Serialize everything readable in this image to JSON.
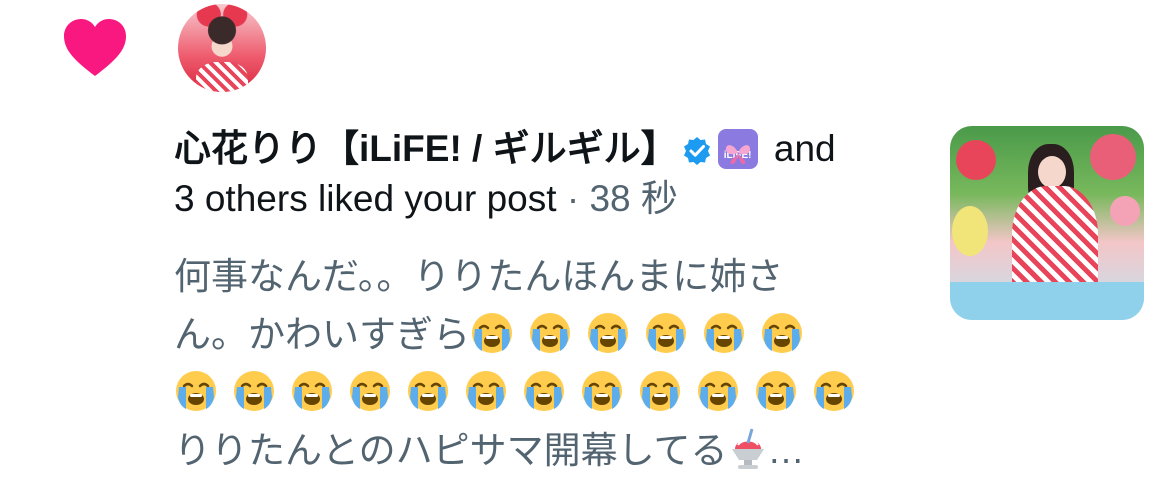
{
  "notification": {
    "type_icon": "heart-icon",
    "type_color": "#f91880",
    "avatar": "user-avatar",
    "user_name": "心花りり【iLiFE! / ギルギル】",
    "verified_icon": "verified-badge-icon",
    "verified_color": "#1d9bf0",
    "affiliate_badge_text": "iLiFE!",
    "action_line_1": " and",
    "action_line_2": "3 others liked your post",
    "separator": " · ",
    "time": "38 秒",
    "post_text": {
      "line1": "何事なんだ。。りりたんほんまに姉さ",
      "line2_prefix": "ん。かわいすぎら",
      "crying_emoji_count_line2": 6,
      "crying_emoji_count_line3": 12,
      "line4": "りりたんとのハピサマ開幕してる",
      "ellipsis": "…"
    },
    "thumbnail": "post-media-thumbnail"
  }
}
